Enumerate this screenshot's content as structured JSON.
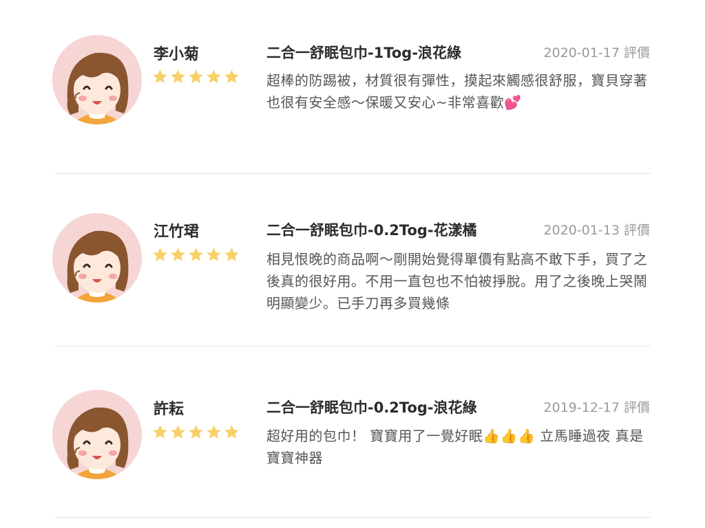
{
  "reviews": [
    {
      "reviewer": "李小菊",
      "rating": 5,
      "product": "二合一舒眠包巾-1Tog-浪花綠",
      "date_label": "2020-01-17 評價",
      "comment": "超棒的防踢被，材質很有彈性，摸起來觸感很舒服，寶貝穿著也很有安全感～保暖又安心~非常喜歡💕"
    },
    {
      "reviewer": "江竹珺",
      "rating": 5,
      "product": "二合一舒眠包巾-0.2Tog-花漾橘",
      "date_label": "2020-01-13 評價",
      "comment": "相見恨晚的商品啊～剛開始覺得單價有點高不敢下手，買了之後真的很好用。不用一直包也不怕被掙脫。用了之後晚上哭鬧明顯變少。已手刀再多買幾條"
    },
    {
      "reviewer": "許耘",
      "rating": 5,
      "product": "二合一舒眠包巾-0.2Tog-浪花綠",
      "date_label": "2019-12-17 評價",
      "comment": "超好用的包巾！ 寶寶用了一覺好眠👍👍👍 立馬睡過夜 真是寶寶神器"
    }
  ],
  "colors": {
    "star": "#f6d16a",
    "avatar_bg": "#f6d5d5",
    "hair": "#8a5630",
    "shirt": "#f3a43a",
    "divider": "#e4e4e4"
  },
  "icons": {
    "avatar": "girl-avatar-icon",
    "star": "star-icon"
  }
}
